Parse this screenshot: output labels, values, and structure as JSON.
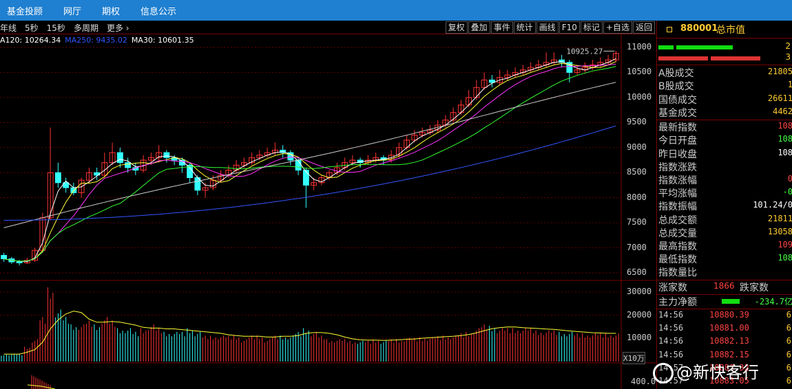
{
  "topnav": {
    "items": [
      "基金投顾",
      "网厅",
      "期权",
      "信息公示"
    ]
  },
  "toolbar": {
    "left": [
      "年线",
      "5秒",
      "15秒",
      "多周期",
      "更多"
    ],
    "right": [
      "复权",
      "叠加",
      "事件",
      "统计",
      "画线",
      "F10",
      "标记",
      "+自选",
      "返回"
    ]
  },
  "ma_legend": [
    {
      "text": "A120: 10264.34",
      "color": "#ffffff"
    },
    {
      "text": "MA250: 9435.02",
      "color": "#3355ff"
    },
    {
      "text": "MA30: 10601.35",
      "color": "#ffffff"
    }
  ],
  "chart": {
    "high_label": "10925.27",
    "y_ticks": [
      "11000",
      "10500",
      "10000",
      "9500",
      "9000",
      "8500",
      "8000",
      "7500",
      "7000",
      "6500"
    ],
    "vol_ticks": [
      "30000",
      "20000",
      "10000"
    ],
    "vol_unit": "X10万",
    "macd_tick": "400.0"
  },
  "rightpanel": {
    "code": "880001",
    "name": "总市值",
    "bar_vals": [
      "2",
      "3"
    ],
    "turnover": [
      {
        "label": "A股成交",
        "value": "21805"
      },
      {
        "label": "B股成交",
        "value": "1"
      },
      {
        "label": "国债成交",
        "value": "26611"
      },
      {
        "label": "基金成交",
        "value": "4462"
      }
    ],
    "stats": [
      {
        "label": "最新指数",
        "value": "108",
        "color": "#ff4444"
      },
      {
        "label": "今日开盘",
        "value": "108",
        "color": "#44ff44"
      },
      {
        "label": "昨日收盘",
        "value": "108",
        "color": "#ffffff"
      },
      {
        "label": "指数涨跌",
        "value": "",
        "color": "#ff4444"
      },
      {
        "label": "指数涨幅",
        "value": "0",
        "color": "#ff4444"
      },
      {
        "label": "平均涨幅",
        "value": "-0",
        "color": "#44ff44"
      },
      {
        "label": "指数振幅",
        "value": "101.24/0",
        "color": "#ffffff"
      },
      {
        "label": "总成交额",
        "value": "21811",
        "color": "#ffcc33"
      },
      {
        "label": "总成交量",
        "value": "13058",
        "color": "#ffcc33"
      },
      {
        "label": "最高指数",
        "value": "109",
        "color": "#ff4444"
      },
      {
        "label": "最低指数",
        "value": "108",
        "color": "#44ff44"
      },
      {
        "label": "指数量比",
        "value": "",
        "color": "#ffffff"
      }
    ],
    "updown": {
      "up_label": "涨家数",
      "up_val": "1866",
      "down_label": "跌家数"
    },
    "net": {
      "label": "主力净额",
      "value": "-234.7亿"
    },
    "ticks": [
      {
        "time": "14:56",
        "price": "10880.39",
        "vol": "6"
      },
      {
        "time": "14:56",
        "price": "10881.00",
        "vol": "6"
      },
      {
        "time": "14:56",
        "price": "10882.13",
        "vol": "6"
      },
      {
        "time": "14:56",
        "price": "10882.15",
        "vol": "6"
      },
      {
        "time": "14:57",
        "price": "10882.32",
        "vol": "6"
      },
      {
        "time": "14:57",
        "price": "10883.05",
        "vol": "6"
      }
    ]
  },
  "watermark": "@新快客行",
  "chart_data": {
    "type": "candlestick",
    "y_range": [
      6350,
      11150
    ],
    "candles": [
      [
        6850,
        6780,
        6900,
        6720
      ],
      [
        6780,
        6720,
        6820,
        6680
      ],
      [
        6720,
        6700,
        6760,
        6650
      ],
      [
        6700,
        6750,
        6800,
        6680
      ],
      [
        6750,
        6950,
        7000,
        6720
      ],
      [
        6950,
        7600,
        7700,
        6900
      ],
      [
        7600,
        8500,
        9400,
        7550
      ],
      [
        8500,
        8300,
        8700,
        8200
      ],
      [
        8300,
        8200,
        8400,
        8100
      ],
      [
        8200,
        8100,
        8300,
        8050
      ],
      [
        8100,
        8350,
        8400,
        8000
      ],
      [
        8350,
        8500,
        8600,
        8300
      ],
      [
        8500,
        8450,
        8600,
        8350
      ],
      [
        8450,
        8700,
        8900,
        8400
      ],
      [
        8700,
        8900,
        9100,
        8650
      ],
      [
        8900,
        8700,
        9000,
        8600
      ],
      [
        8700,
        8600,
        8800,
        8500
      ],
      [
        8600,
        8550,
        8700,
        8450
      ],
      [
        8550,
        8750,
        8850,
        8500
      ],
      [
        8750,
        8800,
        8900,
        8650
      ],
      [
        8800,
        8900,
        9050,
        8700
      ],
      [
        8900,
        8800,
        8950,
        8700
      ],
      [
        8800,
        8750,
        8850,
        8650
      ],
      [
        8750,
        8650,
        8800,
        8500
      ],
      [
        8650,
        8400,
        8700,
        8300
      ],
      [
        8400,
        8150,
        8450,
        8050
      ],
      [
        8150,
        8200,
        8300,
        8000
      ],
      [
        8200,
        8350,
        8450,
        8150
      ],
      [
        8350,
        8450,
        8550,
        8300
      ],
      [
        8450,
        8550,
        8650,
        8400
      ],
      [
        8550,
        8650,
        8750,
        8500
      ],
      [
        8650,
        8700,
        8800,
        8600
      ],
      [
        8700,
        8800,
        8900,
        8650
      ],
      [
        8800,
        8850,
        8950,
        8750
      ],
      [
        8850,
        8900,
        9000,
        8800
      ],
      [
        8900,
        8950,
        9100,
        8850
      ],
      [
        8950,
        8900,
        9050,
        8800
      ],
      [
        8900,
        8750,
        8950,
        8650
      ],
      [
        8750,
        8550,
        8800,
        8450
      ],
      [
        8550,
        8250,
        8600,
        7800
      ],
      [
        8250,
        8300,
        8400,
        8150
      ],
      [
        8300,
        8400,
        8450,
        8250
      ],
      [
        8400,
        8500,
        8550,
        8350
      ],
      [
        8500,
        8600,
        8700,
        8450
      ],
      [
        8600,
        8700,
        8800,
        8550
      ],
      [
        8700,
        8750,
        8850,
        8650
      ],
      [
        8750,
        8700,
        8800,
        8600
      ],
      [
        8700,
        8750,
        8850,
        8650
      ],
      [
        8750,
        8800,
        8900,
        8700
      ],
      [
        8800,
        8750,
        8850,
        8650
      ],
      [
        8750,
        8850,
        8950,
        8700
      ],
      [
        8850,
        9000,
        9100,
        8800
      ],
      [
        9000,
        9150,
        9250,
        8950
      ],
      [
        9150,
        9250,
        9350,
        9100
      ],
      [
        9250,
        9300,
        9400,
        9200
      ],
      [
        9300,
        9350,
        9450,
        9250
      ],
      [
        9350,
        9450,
        9550,
        9300
      ],
      [
        9450,
        9550,
        9650,
        9400
      ],
      [
        9550,
        9700,
        9800,
        9500
      ],
      [
        9700,
        9850,
        9950,
        9650
      ],
      [
        9850,
        10000,
        10150,
        9800
      ],
      [
        10000,
        10200,
        10350,
        9950
      ],
      [
        10200,
        10350,
        10500,
        10150
      ],
      [
        10350,
        10300,
        10450,
        10200
      ],
      [
        10300,
        10400,
        10550,
        10250
      ],
      [
        10400,
        10450,
        10550,
        10350
      ],
      [
        10450,
        10500,
        10600,
        10400
      ],
      [
        10500,
        10550,
        10650,
        10450
      ],
      [
        10550,
        10600,
        10700,
        10500
      ],
      [
        10600,
        10650,
        10750,
        10550
      ],
      [
        10650,
        10700,
        10900,
        10600
      ],
      [
        10700,
        10750,
        10900,
        10650
      ],
      [
        10750,
        10700,
        10850,
        10600
      ],
      [
        10700,
        10500,
        10750,
        10300
      ],
      [
        10500,
        10550,
        10650,
        10450
      ],
      [
        10550,
        10600,
        10700,
        10500
      ],
      [
        10600,
        10650,
        10750,
        10550
      ],
      [
        10650,
        10700,
        10800,
        10600
      ],
      [
        10700,
        10750,
        10850,
        10650
      ],
      [
        10750,
        10880,
        10930,
        10700
      ]
    ],
    "volumes": [
      0.1,
      0.1,
      0.1,
      0.2,
      0.3,
      0.6,
      1.0,
      0.7,
      0.6,
      0.5,
      0.5,
      0.55,
      0.5,
      0.6,
      0.55,
      0.45,
      0.45,
      0.4,
      0.45,
      0.5,
      0.45,
      0.4,
      0.4,
      0.4,
      0.45,
      0.4,
      0.35,
      0.35,
      0.35,
      0.35,
      0.35,
      0.3,
      0.35,
      0.35,
      0.3,
      0.35,
      0.35,
      0.35,
      0.4,
      0.45,
      0.4,
      0.35,
      0.3,
      0.3,
      0.3,
      0.28,
      0.28,
      0.28,
      0.3,
      0.28,
      0.3,
      0.3,
      0.32,
      0.32,
      0.33,
      0.33,
      0.34,
      0.35,
      0.35,
      0.38,
      0.4,
      0.45,
      0.5,
      0.48,
      0.45,
      0.45,
      0.45,
      0.45,
      0.45,
      0.42,
      0.42,
      0.42,
      0.4,
      0.4,
      0.38,
      0.38,
      0.38,
      0.38,
      0.38,
      0.38
    ]
  }
}
